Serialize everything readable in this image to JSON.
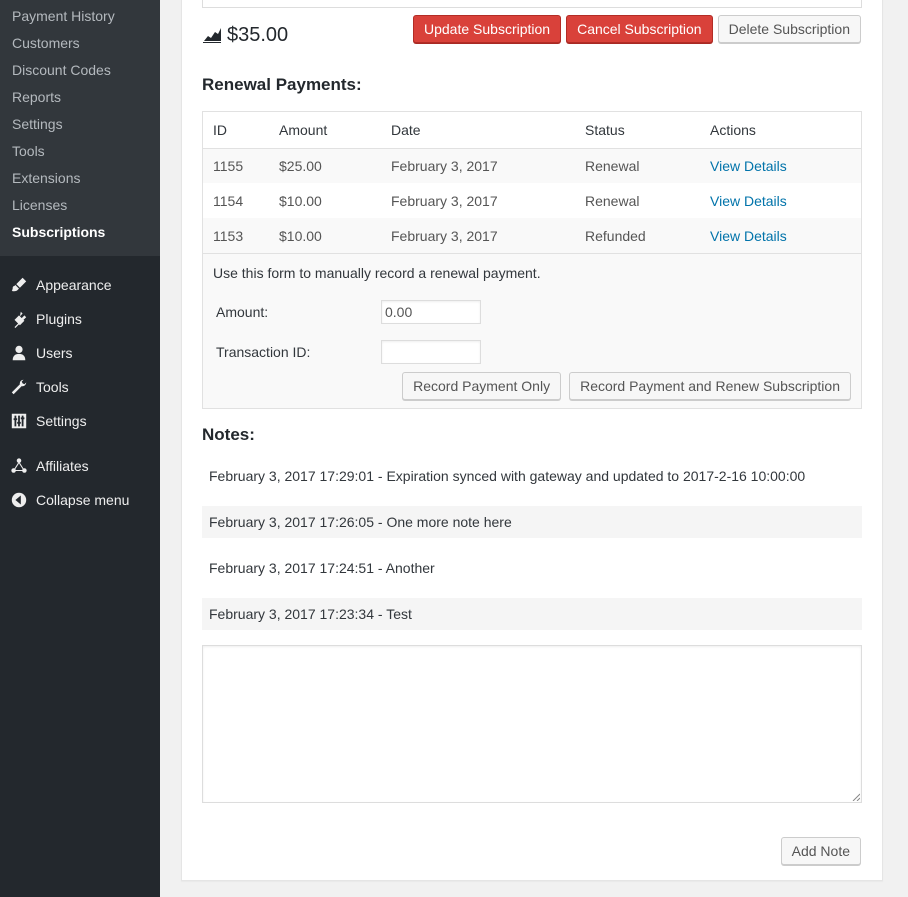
{
  "sidebar": {
    "submenu": [
      {
        "label": "Payment History",
        "current": false
      },
      {
        "label": "Customers",
        "current": false
      },
      {
        "label": "Discount Codes",
        "current": false
      },
      {
        "label": "Reports",
        "current": false
      },
      {
        "label": "Settings",
        "current": false
      },
      {
        "label": "Tools",
        "current": false
      },
      {
        "label": "Extensions",
        "current": false
      },
      {
        "label": "Licenses",
        "current": false
      },
      {
        "label": "Subscriptions",
        "current": true
      }
    ],
    "menu": [
      {
        "label": "Appearance",
        "icon": "paintbrush-icon"
      },
      {
        "label": "Plugins",
        "icon": "plugin-icon"
      },
      {
        "label": "Users",
        "icon": "user-icon"
      },
      {
        "label": "Tools",
        "icon": "wrench-icon"
      },
      {
        "label": "Settings",
        "icon": "sliders-icon"
      },
      {
        "label": "Affiliates",
        "icon": "affiliates-icon"
      },
      {
        "label": "Collapse menu",
        "icon": "collapse-icon"
      }
    ]
  },
  "subscription": {
    "amount": "$35.00",
    "buttons": {
      "update": "Update Subscription",
      "cancel": "Cancel Subscription",
      "delete": "Delete Subscription"
    }
  },
  "renewals": {
    "heading": "Renewal Payments:",
    "columns": [
      "ID",
      "Amount",
      "Date",
      "Status",
      "Actions"
    ],
    "rows": [
      {
        "id": "1155",
        "amount": "$25.00",
        "date": "February 3, 2017",
        "status": "Renewal",
        "action": "View Details"
      },
      {
        "id": "1154",
        "amount": "$10.00",
        "date": "February 3, 2017",
        "status": "Renewal",
        "action": "View Details"
      },
      {
        "id": "1153",
        "amount": "$10.00",
        "date": "February 3, 2017",
        "status": "Refunded",
        "action": "View Details"
      }
    ],
    "form": {
      "intro": "Use this form to manually record a renewal payment.",
      "amount_label": "Amount:",
      "amount_value": "0.00",
      "transaction_label": "Transaction ID:",
      "transaction_value": "",
      "record_only": "Record Payment Only",
      "record_renew": "Record Payment and Renew Subscription"
    }
  },
  "notes": {
    "heading": "Notes:",
    "items": [
      "February 3, 2017 17:29:01 - Expiration synced with gateway and updated to 2017-2-16 10:00:00",
      "February 3, 2017 17:26:05 - One more note here",
      "February 3, 2017 17:24:51 - Another",
      "February 3, 2017 17:23:34 - Test"
    ],
    "textarea_value": "",
    "add_button": "Add Note"
  },
  "colors": {
    "sidebar_bg": "#23282d",
    "submenu_bg": "#32373c",
    "danger": "#d9413a",
    "link": "#0073aa"
  }
}
